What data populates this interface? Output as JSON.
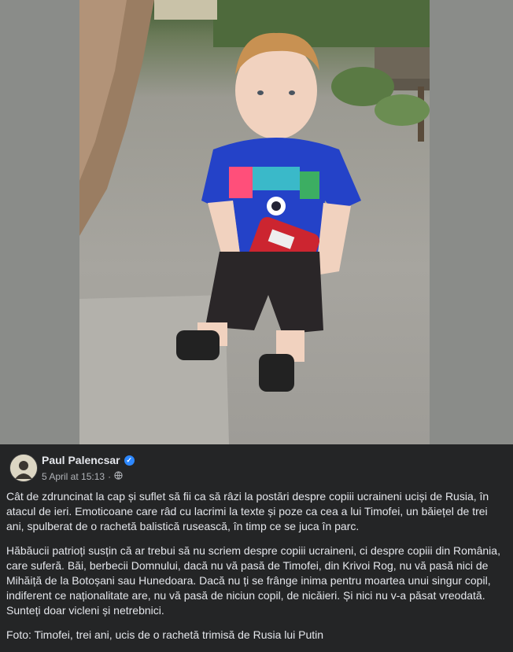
{
  "post": {
    "author": "Paul Palencsar",
    "timestamp": "5 April at 15:13",
    "meta_separator": "·",
    "paragraphs": [
      "Cât de zdruncinat la cap și suflet să fii ca să râzi la postări despre copiii ucraineni uciși de Rusia, în atacul de ieri. Emoticoane care râd cu lacrimi la texte și poze ca cea a lui Timofei, un băiețel de trei ani, spulberat de o rachetă balistică rusească, în timp ce se juca în parc.",
      "Hăbăucii patrioți susțin că ar trebui să nu scriem despre copiii ucraineni, ci despre copiii din România, care suferă. Băi, berbecii Domnului, dacă nu vă pasă de Timofei, din Krivoi Rog, nu vă pasă nici de Mihăiță de la Botoșani sau Hunedoara. Dacă nu ți se frânge inima pentru moartea unui singur copil, indiferent ce naționalitate are, nu vă pasă de niciun copil, de nicăieri. Și nici nu v-a păsat vreodată. Sunteți doar vicleni și netrebnici.",
      "Foto: Timofei, trei ani, ucis de o rachetă trimisă de Rusia lui Putin"
    ]
  },
  "icons": {
    "verified": "verified-badge-icon",
    "audience": "globe-icon"
  },
  "colors": {
    "background": "#242526",
    "text": "#e4e6eb",
    "secondary_text": "#b0b3b8",
    "verified": "#2d88ff",
    "photo_frame": "#8a8c89"
  }
}
